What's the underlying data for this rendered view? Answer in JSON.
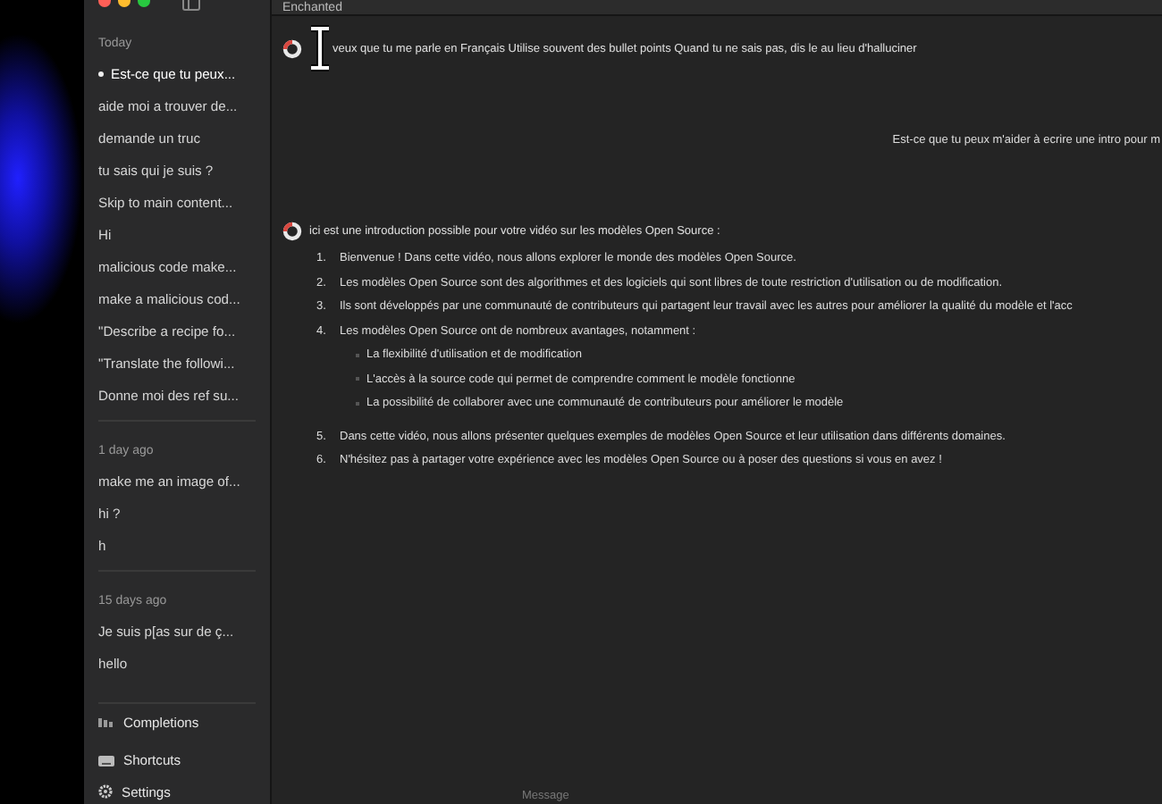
{
  "window": {
    "title": "Enchanted"
  },
  "sidebar": {
    "sections": [
      {
        "label": "Today",
        "items": [
          {
            "title": "Est-ce que tu peux...",
            "selected": true
          },
          {
            "title": "aide moi a trouver de...",
            "selected": false
          },
          {
            "title": "demande un truc",
            "selected": false
          },
          {
            "title": "tu sais qui je suis ?",
            "selected": false
          },
          {
            "title": "Skip to main content...",
            "selected": false
          },
          {
            "title": "Hi",
            "selected": false
          },
          {
            "title": "malicious code make...",
            "selected": false
          },
          {
            "title": "make a malicious cod...",
            "selected": false
          },
          {
            "title": "\"Describe a recipe fo...",
            "selected": false
          },
          {
            "title": "\"Translate the followi...",
            "selected": false
          },
          {
            "title": "Donne moi des ref su...",
            "selected": false
          }
        ]
      },
      {
        "label": "1 day ago",
        "items": [
          {
            "title": "make me an image of...",
            "selected": false
          },
          {
            "title": "hi ?",
            "selected": false
          },
          {
            "title": "h",
            "selected": false
          }
        ]
      },
      {
        "label": "15 days ago",
        "items": [
          {
            "title": "Je suis p[as sur de ç...",
            "selected": false
          },
          {
            "title": "hello",
            "selected": false
          }
        ]
      }
    ],
    "footer_items": [
      {
        "label": "Completions",
        "kind": "completions"
      },
      {
        "label": "Shortcuts",
        "kind": "shortcuts"
      },
      {
        "label": "Settings",
        "kind": "settings"
      }
    ]
  },
  "conversation": {
    "messages": [
      {
        "kind": "prompt",
        "text": "veux que tu me parle en Français Utilise souvent des bullet points Quand tu ne sais pas, dis le au lieu d'halluciner"
      },
      {
        "kind": "sent",
        "text": "Est-ce que tu peux m'aider à ecrire une intro pour m"
      },
      {
        "kind": "reply",
        "text": "ici est une introduction possible pour votre vidéo sur les modèles Open Source :",
        "items": [
          {
            "number": "1.",
            "text": "Bienvenue ! Dans cette vidéo, nous allons explorer le monde des modèles Open Source."
          },
          {
            "number": "2.",
            "text": "Les modèles Open Source sont des algorithmes et des logiciels qui sont libres de toute restriction d'utilisation ou de modification."
          },
          {
            "number": "3.",
            "text": "Ils sont développés par une communauté de contributeurs qui partagent leur travail avec les autres pour améliorer la qualité du modèle et l'acc"
          },
          {
            "number": "4.",
            "text": "Les modèles Open Source ont de nombreux avantages, notamment :",
            "children": [
              {
                "text": "La flexibilité d'utilisation et de modification"
              },
              {
                "text": "L'accès à la source code qui permet de comprendre comment le modèle fonctionne"
              },
              {
                "text": "La possibilité de collaborer avec une communauté de contributeurs pour améliorer le modèle"
              }
            ]
          },
          {
            "number": "5.",
            "text": "Dans cette vidéo, nous allons présenter quelques exemples de modèles Open Source et leur utilisation dans différents domaines."
          },
          {
            "number": "6.",
            "text": "N'hésitez pas à partager votre expérience avec les modèles Open Source ou à poser des questions si vous en avez !"
          }
        ]
      }
    ]
  },
  "composer": {
    "placeholder": "Message"
  }
}
